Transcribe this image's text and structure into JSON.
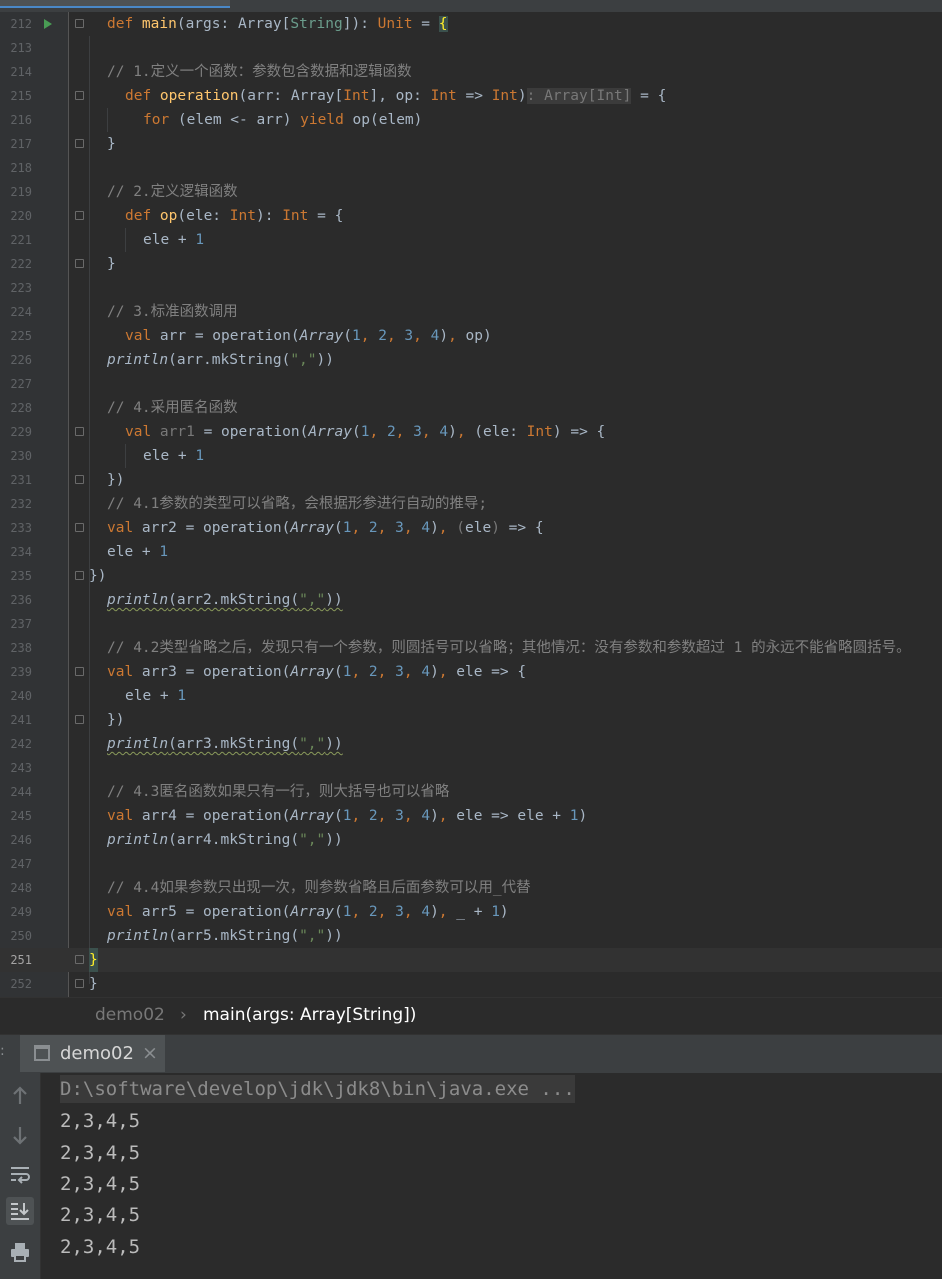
{
  "editor": {
    "lines": [
      {
        "n": "212",
        "t": "def main(args: Array[String]): Unit = {"
      },
      {
        "n": "213",
        "t": ""
      },
      {
        "n": "214",
        "t": "// 1.定义一个函数：参数包含数据和逻辑函数"
      },
      {
        "n": "215",
        "t": "def operation(arr: Array[Int], op: Int => Int): Array[Int] = {"
      },
      {
        "n": "216",
        "t": "for (elem <- arr) yield op(elem)"
      },
      {
        "n": "217",
        "t": "}"
      },
      {
        "n": "218",
        "t": ""
      },
      {
        "n": "219",
        "t": "// 2.定义逻辑函数"
      },
      {
        "n": "220",
        "t": "def op(ele: Int): Int = {"
      },
      {
        "n": "221",
        "t": "ele + 1"
      },
      {
        "n": "222",
        "t": "}"
      },
      {
        "n": "223",
        "t": ""
      },
      {
        "n": "224",
        "t": "// 3.标准函数调用"
      },
      {
        "n": "225",
        "t": "val arr = operation(Array(1, 2, 3, 4), op)"
      },
      {
        "n": "226",
        "t": "println(arr.mkString(\",\"))"
      },
      {
        "n": "227",
        "t": ""
      },
      {
        "n": "228",
        "t": "// 4.采用匿名函数"
      },
      {
        "n": "229",
        "t": "val arr1 = operation(Array(1, 2, 3, 4), (ele: Int) => {"
      },
      {
        "n": "230",
        "t": "ele + 1"
      },
      {
        "n": "231",
        "t": "})"
      },
      {
        "n": "232",
        "t": "// 4.1参数的类型可以省略，会根据形参进行自动的推导;"
      },
      {
        "n": "233",
        "t": "val arr2 = operation(Array(1, 2, 3, 4), (ele) => {"
      },
      {
        "n": "234",
        "t": "ele + 1"
      },
      {
        "n": "235",
        "t": "})"
      },
      {
        "n": "236",
        "t": "println(arr2.mkString(\",\"))"
      },
      {
        "n": "237",
        "t": ""
      },
      {
        "n": "238",
        "t": "// 4.2类型省略之后，发现只有一个参数，则圆括号可以省略；其他情况：没有参数和参数超过 1 的永远不能省略圆括号。"
      },
      {
        "n": "239",
        "t": "val arr3 = operation(Array(1, 2, 3, 4), ele => {"
      },
      {
        "n": "240",
        "t": "ele + 1"
      },
      {
        "n": "241",
        "t": "})"
      },
      {
        "n": "242",
        "t": "println(arr3.mkString(\",\"))"
      },
      {
        "n": "243",
        "t": ""
      },
      {
        "n": "244",
        "t": "// 4.3匿名函数如果只有一行，则大括号也可以省略"
      },
      {
        "n": "245",
        "t": "val arr4 = operation(Array(1, 2, 3, 4), ele => ele + 1)"
      },
      {
        "n": "246",
        "t": "println(arr4.mkString(\",\"))"
      },
      {
        "n": "247",
        "t": ""
      },
      {
        "n": "248",
        "t": "// 4.4如果参数只出现一次，则参数省略且后面参数可以用_代替"
      },
      {
        "n": "249",
        "t": "val arr5 = operation(Array(1, 2, 3, 4), _ + 1)"
      },
      {
        "n": "250",
        "t": "println(arr5.mkString(\",\"))"
      },
      {
        "n": "251",
        "t": "}"
      },
      {
        "n": "252",
        "t": "}"
      }
    ]
  },
  "breadcrumb": {
    "object": "demo02",
    "separator": "›",
    "method": "main(args: Array[String])"
  },
  "run_panel": {
    "tab_label": "demo02",
    "close_glyph": "×",
    "dots": ":"
  },
  "console": {
    "command": "D:\\software\\develop\\jdk\\jdk8\\bin\\java.exe ...",
    "output": [
      "2,3,4,5",
      "2,3,4,5",
      "2,3,4,5",
      "2,3,4,5",
      "2,3,4,5"
    ]
  },
  "toolbar_icons": [
    "up-arrow-icon",
    "down-arrow-icon",
    "soft-wrap-icon",
    "scroll-to-end-icon",
    "print-icon"
  ],
  "colors": {
    "keyword": "#cc7832",
    "function": "#ffc66d",
    "number": "#6897bb",
    "string": "#6a8759",
    "comment": "#808080",
    "text": "#a9b7c6",
    "run_arrow": "#499c54"
  }
}
